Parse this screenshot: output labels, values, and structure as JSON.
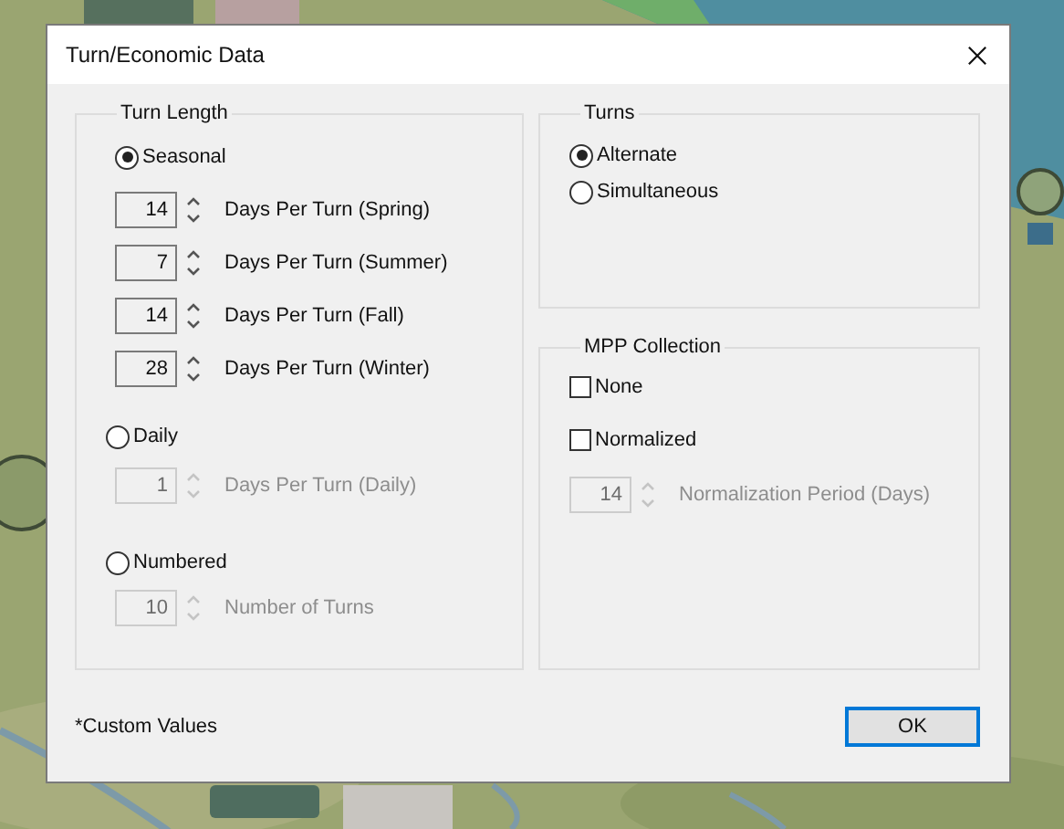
{
  "window": {
    "title": "Turn/Economic Data"
  },
  "turn_length": {
    "title": "Turn Length",
    "options": [
      {
        "label": "Seasonal",
        "selected": true,
        "fields": [
          {
            "value": "14",
            "label": "Days Per Turn (Spring)",
            "disabled": false
          },
          {
            "value": "7",
            "label": "Days Per Turn (Summer)",
            "disabled": false
          },
          {
            "value": "14",
            "label": "Days Per Turn (Fall)",
            "disabled": false
          },
          {
            "value": "28",
            "label": "Days Per Turn (Winter)",
            "disabled": false
          }
        ]
      },
      {
        "label": "Daily",
        "selected": false,
        "fields": [
          {
            "value": "1",
            "label": "Days Per Turn (Daily)",
            "disabled": true
          }
        ]
      },
      {
        "label": "Numbered",
        "selected": false,
        "fields": [
          {
            "value": "10",
            "label": "Number of Turns",
            "disabled": true
          }
        ]
      }
    ]
  },
  "turns": {
    "title": "Turns",
    "options": [
      {
        "label": "Alternate",
        "selected": true
      },
      {
        "label": "Simultaneous",
        "selected": false
      }
    ]
  },
  "mpp_collection": {
    "title": "MPP Collection",
    "checkboxes": [
      {
        "label": "None",
        "checked": false
      },
      {
        "label": "Normalized",
        "checked": false
      }
    ],
    "field": {
      "value": "14",
      "label": "Normalization Period (Days)",
      "disabled": true
    }
  },
  "footnote": "*Custom Values",
  "ok_button": "OK"
}
